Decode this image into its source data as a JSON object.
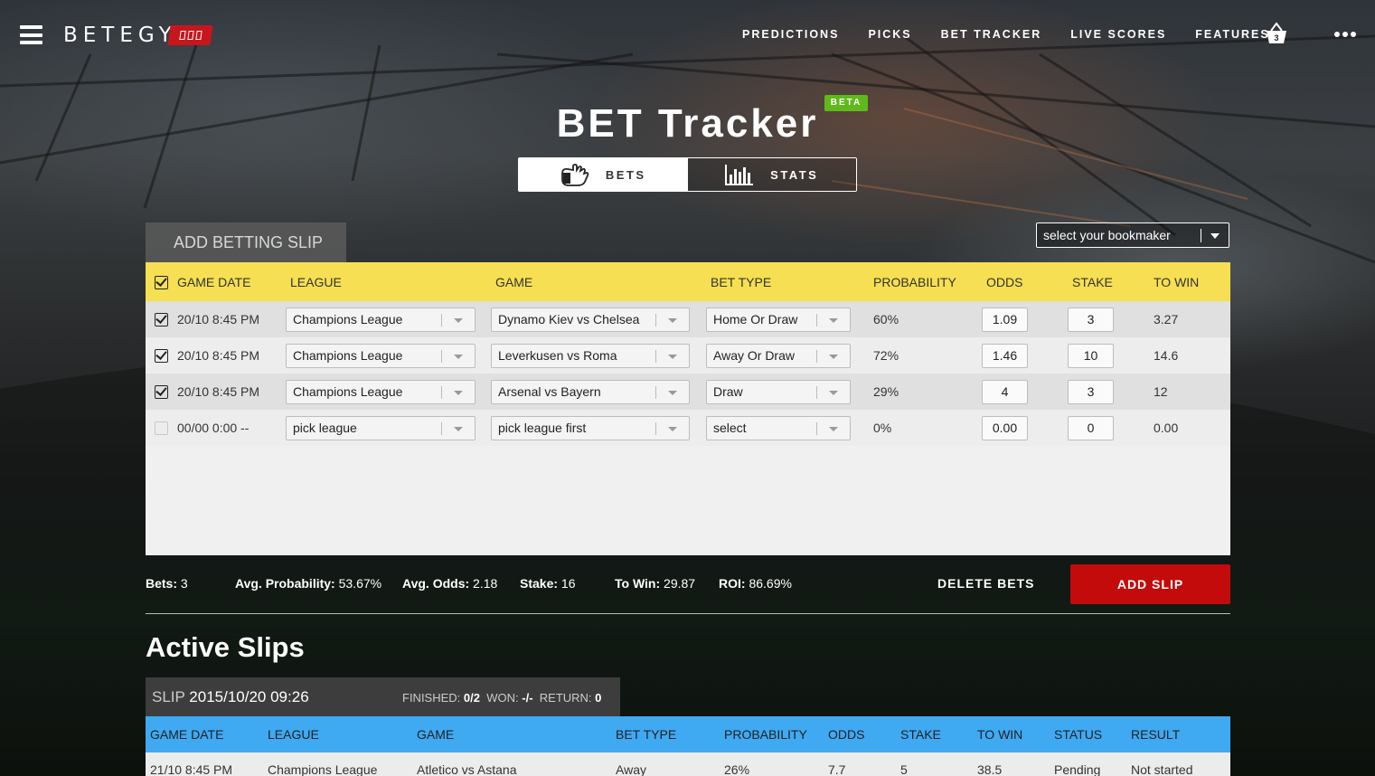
{
  "header": {
    "brand": "BETEGY",
    "nav": [
      "PREDICTIONS",
      "PICKS",
      "BET TRACKER",
      "LIVE SCORES",
      "FEATURES"
    ],
    "cart_count": "3"
  },
  "title": "BET Tracker",
  "beta_label": "BETA",
  "toggle": {
    "bets": "BETS",
    "stats": "STATS"
  },
  "add_tab_label": "ADD BETTING SLIP",
  "bookmaker": {
    "placeholder": "select your bookmaker"
  },
  "bet_table": {
    "headers": {
      "game_date": "GAME DATE",
      "league": "LEAGUE",
      "game": "GAME",
      "bet_type": "BET TYPE",
      "probability": "PROBABILITY",
      "odds": "ODDS",
      "stake": "STAKE",
      "to_win": "TO WIN"
    },
    "rows": [
      {
        "checked": true,
        "date": "20/10 8:45 PM",
        "league": "Champions League",
        "game": "Dynamo Kiev vs Chelsea",
        "bet_type": "Home Or Draw",
        "probability": "60%",
        "odds": "1.09",
        "stake": "3",
        "to_win": "3.27"
      },
      {
        "checked": true,
        "date": "20/10 8:45 PM",
        "league": "Champions League",
        "game": "Leverkusen vs Roma",
        "bet_type": "Away Or Draw",
        "probability": "72%",
        "odds": "1.46",
        "stake": "10",
        "to_win": "14.6"
      },
      {
        "checked": true,
        "date": "20/10 8:45 PM",
        "league": "Champions League",
        "game": "Arsenal vs Bayern",
        "bet_type": "Draw",
        "probability": "29%",
        "odds": "4",
        "stake": "3",
        "to_win": "12"
      },
      {
        "checked": false,
        "date": "00/00 0:00 --",
        "league": "pick league",
        "game": "pick league first",
        "bet_type": "select",
        "probability": "0%",
        "odds": "0.00",
        "stake": "0",
        "to_win": "0.00"
      }
    ]
  },
  "summary": {
    "bets_label": "Bets:",
    "bets": "3",
    "avg_prob_label": "Avg. Probability:",
    "avg_prob": "53.67%",
    "avg_odds_label": "Avg. Odds:",
    "avg_odds": "2.18",
    "stake_label": "Stake:",
    "stake": "16",
    "to_win_label": "To Win:",
    "to_win": "29.87",
    "roi_label": "ROI:",
    "roi": "86.69%"
  },
  "delete_label": "DELETE BETS",
  "add_slip_label": "ADD SLIP",
  "active_slips": {
    "title": "Active Slips",
    "slip": {
      "label": "SLIP",
      "datetime": "2015/10/20 09:26",
      "finished_label": "FINISHED:",
      "finished": "0/2",
      "won_label": "WON:",
      "won": "-/-",
      "return_label": "RETURN:",
      "return": "0"
    },
    "headers": [
      "GAME DATE",
      "LEAGUE",
      "GAME",
      "BET TYPE",
      "PROBABILITY",
      "ODDS",
      "STAKE",
      "TO WIN",
      "STATUS",
      "RESULT"
    ],
    "row": [
      "21/10 8:45 PM",
      "Champions League",
      "Atletico vs Astana",
      "Away",
      "26%",
      "7.7",
      "5",
      "38.5",
      "Pending",
      "Not started"
    ]
  },
  "colors": {
    "yellow": "#f6df52",
    "blue": "#3fa9f2",
    "red": "#c30b0b",
    "green_beta": "#5fb91a"
  }
}
